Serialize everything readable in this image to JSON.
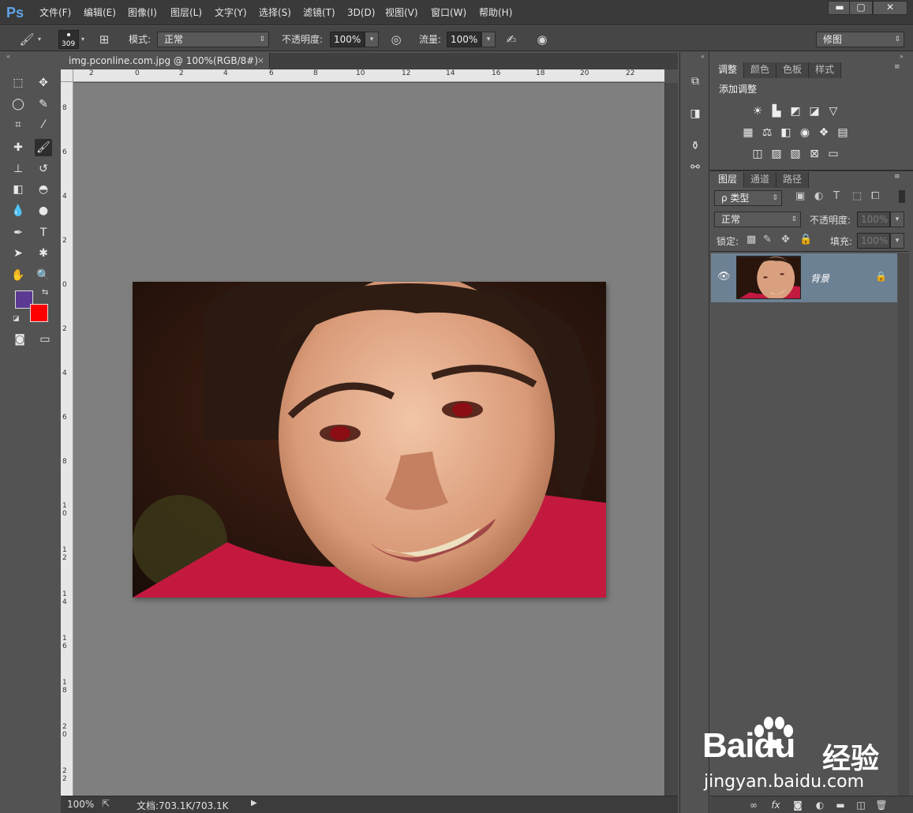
{
  "app": {
    "logo": "Ps",
    "menu": [
      "文件(F)",
      "编辑(E)",
      "图像(I)",
      "图层(L)",
      "文字(Y)",
      "选择(S)",
      "滤镜(T)",
      "3D(D)",
      "视图(V)",
      "窗口(W)",
      "帮助(H)"
    ],
    "window_controls": {
      "minimize": "▬",
      "maximize": "▢",
      "close": "✕"
    }
  },
  "options": {
    "brush_size": "309",
    "mode_label": "模式:",
    "mode_value": "正常",
    "opacity_label": "不透明度:",
    "opacity_value": "100%",
    "flow_label": "流量:",
    "flow_value": "100%",
    "workspace": "修图"
  },
  "document": {
    "tab_title": "img.pconline.com.jpg @ 100%(RGB/8#)",
    "close_glyph": "×",
    "zoom": "100%",
    "doc_info": "文档:703.1K/703.1K",
    "ruler_h_labels": [
      "2",
      "0",
      "2",
      "4",
      "6",
      "8",
      "10",
      "12",
      "14",
      "16",
      "18",
      "20",
      "22"
    ],
    "ruler_v_labels": [
      "8",
      "6",
      "4",
      "2",
      "0",
      "2",
      "4",
      "6",
      "8",
      "10",
      "12",
      "14",
      "16",
      "18",
      "20",
      "22"
    ]
  },
  "colors": {
    "foreground": "#5b3a92",
    "background": "#ff0000",
    "layer_selected": "#6d8194",
    "canvas": "#7f7f7f"
  },
  "adjustments": {
    "tabs": [
      "调整",
      "颜色",
      "色板",
      "样式"
    ],
    "title": "添加调整"
  },
  "layers": {
    "tabs": [
      "图层",
      "通道",
      "路径"
    ],
    "filter_label": "ρ 类型",
    "blend_mode": "正常",
    "opacity_label": "不透明度:",
    "opacity_value": "100%",
    "lock_label": "锁定:",
    "fill_label": "填充:",
    "fill_value": "100%",
    "layer_name": "背景"
  },
  "watermark": {
    "brand": "Bai",
    "brand_suffix": "du",
    "cn": "经验",
    "url": "jingyan.baidu.com"
  }
}
